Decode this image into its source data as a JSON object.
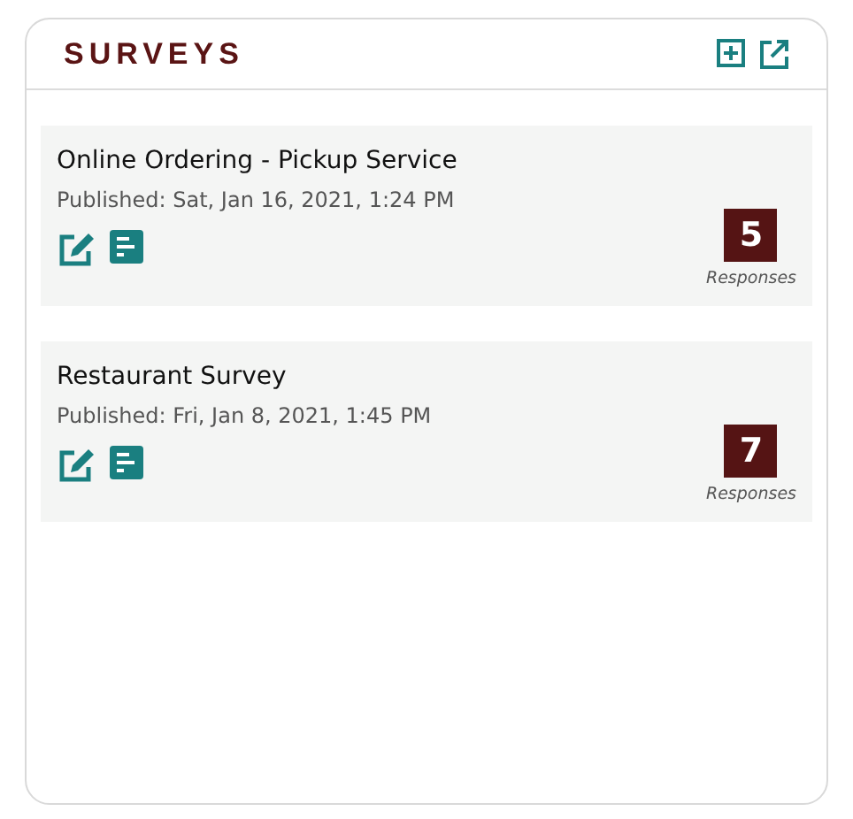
{
  "panel": {
    "title": "SURVEYS"
  },
  "surveys": [
    {
      "name": "Online Ordering - Pickup Service",
      "published": "Published: Sat, Jan 16, 2021, 1:24 PM",
      "responses": "5",
      "responses_label": "Responses"
    },
    {
      "name": "Restaurant Survey",
      "published": "Published: Fri, Jan 8, 2021, 1:45 PM",
      "responses": "7",
      "responses_label": "Responses"
    }
  ]
}
